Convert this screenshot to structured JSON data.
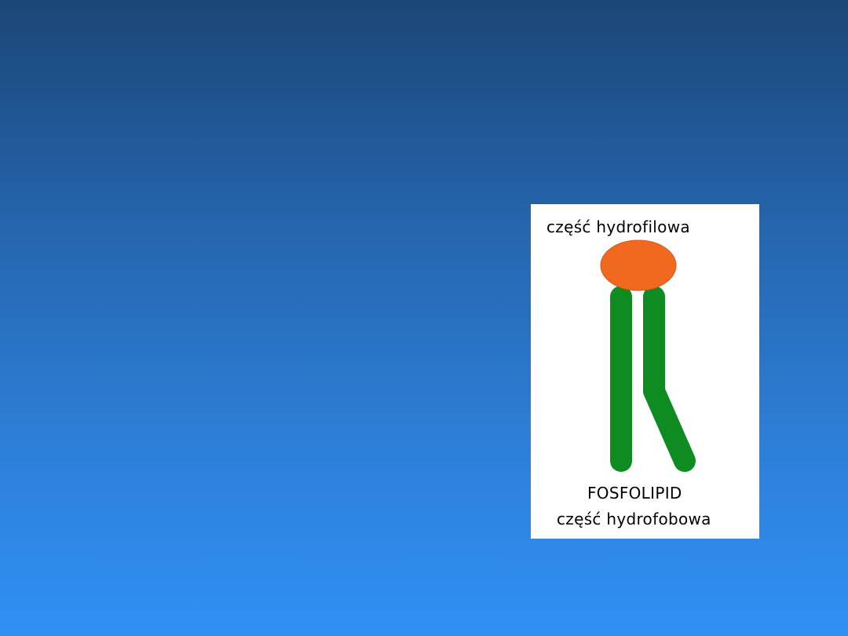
{
  "diagram": {
    "hydrophilic_label": "część hydrofilowa",
    "molecule_name": "FOSFOLIPID",
    "hydrophobic_label": "część hydrofobowa",
    "colors": {
      "background_top": "#1b4677",
      "background_bottom": "#3090f5",
      "head": "#f0691e",
      "tails": "#0f8c21",
      "panel": "#ffffff"
    }
  }
}
